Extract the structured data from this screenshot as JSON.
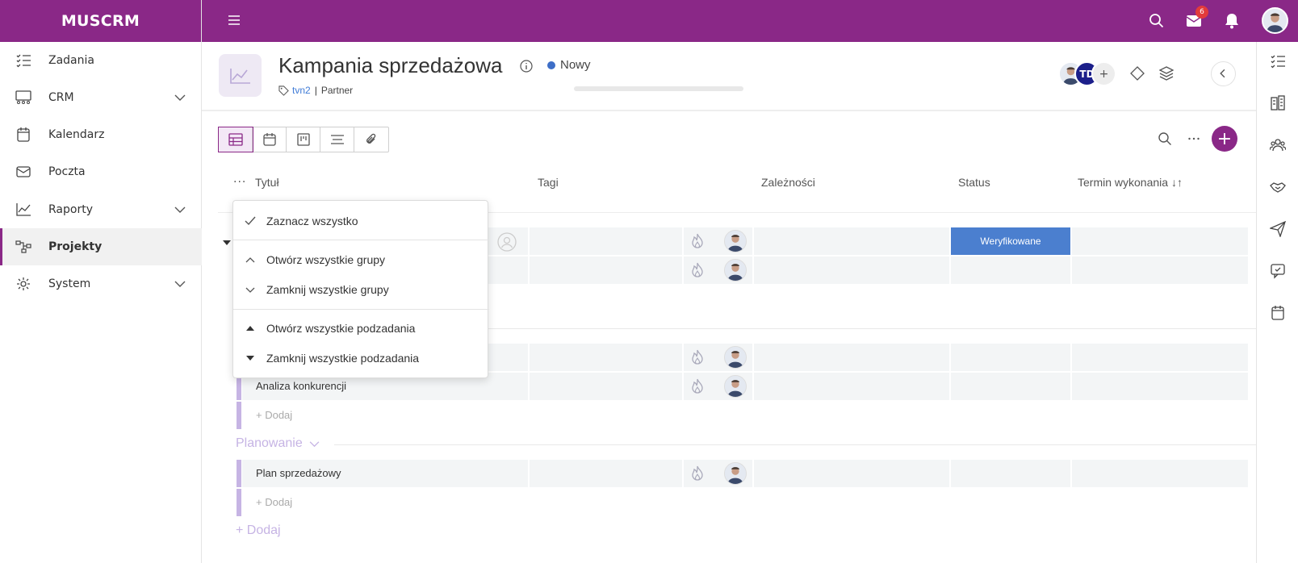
{
  "brand": "MUSCRM",
  "colors": {
    "accent": "#8a2887",
    "status_new": "#3d6ec7",
    "status_verified": "#4b7fcf",
    "group": "#c6b4e4"
  },
  "sidebar": {
    "items": [
      {
        "label": "Zadania",
        "icon": "tasks-icon"
      },
      {
        "label": "CRM",
        "icon": "crm-icon"
      },
      {
        "label": "Kalendarz",
        "icon": "calendar-icon"
      },
      {
        "label": "Poczta",
        "icon": "mail-icon"
      },
      {
        "label": "Raporty",
        "icon": "chart-icon"
      },
      {
        "label": "Projekty",
        "icon": "projects-icon"
      },
      {
        "label": "System",
        "icon": "gear-icon"
      }
    ]
  },
  "topbar": {
    "mail_badge": "6"
  },
  "project": {
    "title": "Kampania sprzedażowa",
    "status": "Nowy",
    "tag": "tvn2",
    "client": "Partner",
    "progress_percent": 0,
    "member_initials": "TD",
    "add_member": "+"
  },
  "toolbar": {
    "add": "+",
    "more": "···"
  },
  "table": {
    "more": "···",
    "columns": {
      "title": "Tytuł",
      "tags": "Tagi",
      "deps": "Zależności",
      "status": "Status",
      "due": "Termin wykonania ↓↑"
    },
    "rows": [
      {
        "title": "",
        "status": "Weryfikowane"
      },
      {
        "title": "",
        "status": ""
      },
      {
        "title": "",
        "status": ""
      },
      {
        "title": "Analiza konkurencji",
        "status": ""
      },
      {
        "title": "Plan sprzedażowy",
        "status": ""
      }
    ],
    "add_label": "+ Dodaj",
    "group_planning": "Planowanie",
    "add_group": "+ Dodaj"
  },
  "menu": {
    "select_all": "Zaznacz wszystko",
    "open_groups": "Otwórz wszystkie grupy",
    "close_groups": "Zamknij wszystkie grupy",
    "open_subtasks": "Otwórz wszystkie podzadania",
    "close_subtasks": "Zamknij wszystkie podzadania"
  }
}
